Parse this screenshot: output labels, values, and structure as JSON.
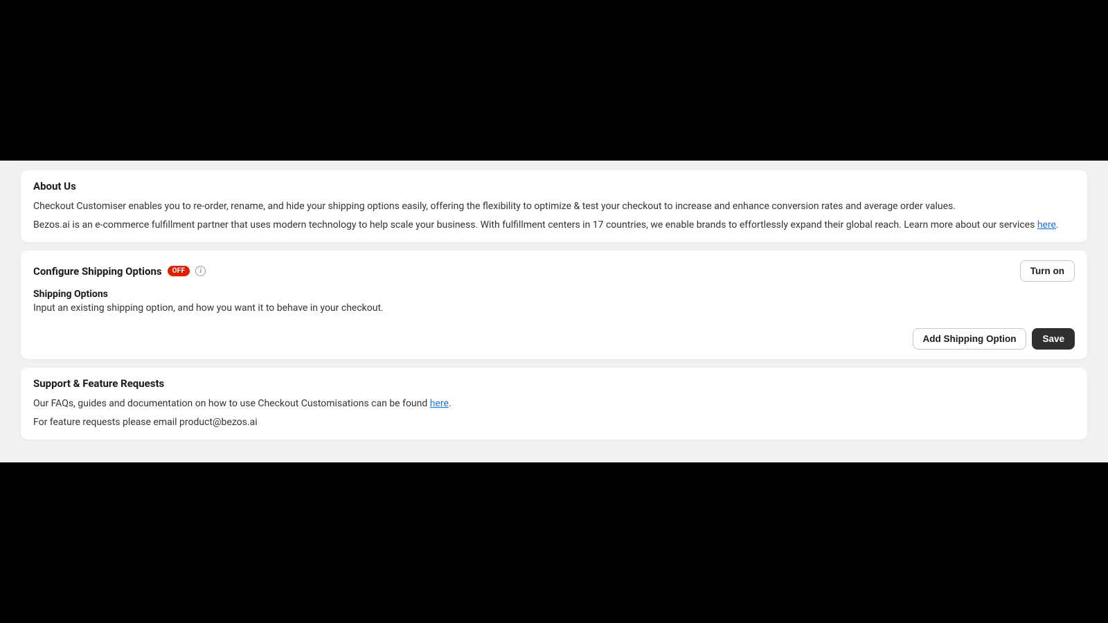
{
  "about": {
    "title": "About Us",
    "p1": "Checkout Customiser enables you to re-order, rename, and hide your shipping options easily, offering the flexibility to optimize & test your checkout to increase and enhance conversion rates and average order values.",
    "p2_prefix": "Bezos.ai is an e-commerce fulfillment partner that uses modern technology to help scale your business. With fulfillment centers in 17 countries, we enable brands to effortlessly expand their global reach. Learn more about our services ",
    "p2_link": "here",
    "p2_suffix": "."
  },
  "config": {
    "title": "Configure Shipping Options",
    "badge": "OFF",
    "turn_on": "Turn on",
    "subheading": "Shipping Options",
    "description": "Input an existing shipping option, and how you want it to behave in your checkout.",
    "add_button": "Add Shipping Option",
    "save_button": "Save"
  },
  "support": {
    "title": "Support & Feature Requests",
    "p1_prefix": "Our FAQs, guides and documentation on how to use Checkout Customisations can be found ",
    "p1_link": "here",
    "p1_suffix": ".",
    "p2": "For feature requests please email product@bezos.ai"
  }
}
